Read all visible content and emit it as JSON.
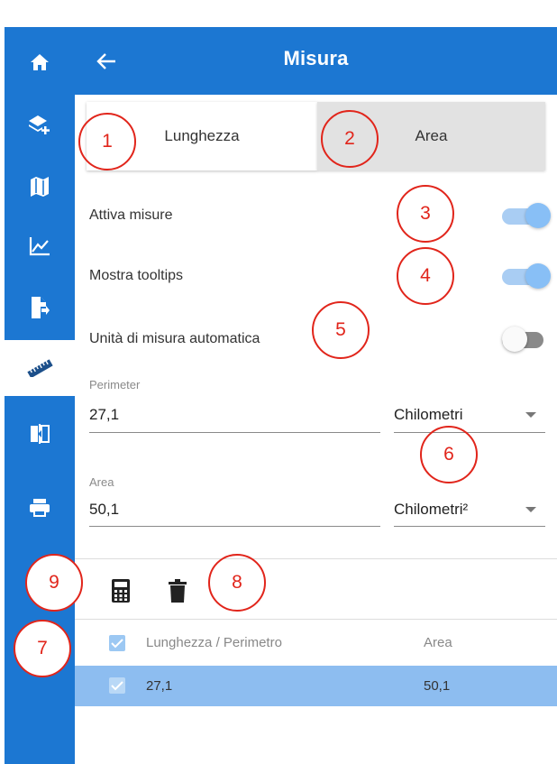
{
  "sidebar": {
    "items": [
      {
        "icon": "home-icon"
      },
      {
        "icon": "add-layer-icon"
      },
      {
        "icon": "map-icon"
      },
      {
        "icon": "chart-icon"
      },
      {
        "icon": "file-export-icon"
      },
      {
        "icon": "ruler-icon",
        "active": true
      },
      {
        "icon": "compare-icon"
      },
      {
        "icon": "print-icon"
      }
    ]
  },
  "header": {
    "title": "Misura",
    "back_icon": "arrow-left-icon"
  },
  "tabs": [
    {
      "label": "Lunghezza",
      "selected": true
    },
    {
      "label": "Area",
      "selected": false
    }
  ],
  "settings": {
    "enable_measures": {
      "label": "Attiva misure",
      "on": true
    },
    "show_tooltips": {
      "label": "Mostra tooltips",
      "on": true
    },
    "auto_unit": {
      "label": "Unità di misura automatica",
      "on": false
    }
  },
  "fields": {
    "perimeter": {
      "label": "Perimeter",
      "value": "27,1",
      "unit": "Chilometri"
    },
    "area": {
      "label": "Area",
      "value": "50,1",
      "unit": "Chilometri²"
    }
  },
  "toolbar": {
    "calculator_icon": "calculator-icon",
    "delete_icon": "trash-icon"
  },
  "table": {
    "columns": [
      "Lunghezza / Perimetro",
      "Area"
    ],
    "rows": [
      {
        "length": "27,1",
        "area": "50,1",
        "checked": true
      }
    ]
  },
  "callouts": [
    "1",
    "2",
    "3",
    "4",
    "5",
    "6",
    "7",
    "8",
    "9"
  ],
  "colors": {
    "primary": "#1c77d2",
    "toggle_on": "#88bff6",
    "selected_row": "#8dbdf0",
    "callout": "#e1251b"
  }
}
